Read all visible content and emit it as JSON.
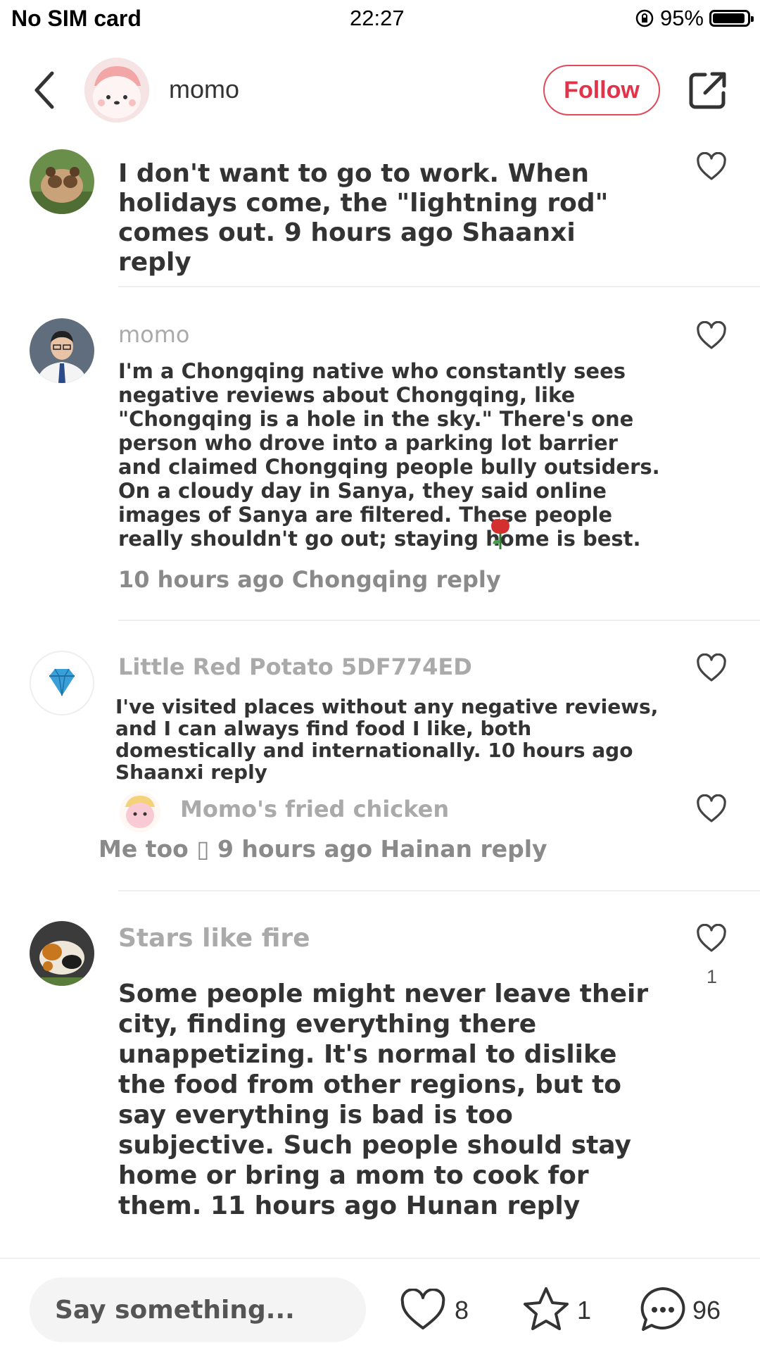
{
  "status_bar": {
    "carrier": "No SIM card",
    "time": "22:27",
    "battery": "95%",
    "battery_level": 0.95
  },
  "header": {
    "username": "momo",
    "follow_label": "Follow"
  },
  "comments": [
    {
      "text": "I don't want to go to work. When holidays come, the \"lightning rod\" comes out. 9 hours ago Shaanxi reply"
    },
    {
      "username": "momo",
      "text": "I'm a Chongqing native who constantly sees negative reviews about Chongqing, like \"Chongqing is a hole in the sky.\" There's one person who drove into a parking lot barrier and claimed Chongqing people bully outsiders. On a cloudy day in Sanya, they said online images of Sanya are filtered. These people really shouldn't go out; staying home is best.",
      "meta": "10 hours ago Chongqing reply"
    },
    {
      "username": "Little Red Potato 5DF774ED",
      "text": "I've visited places without any negative reviews, and I can always find food I like, both domestically and internationally. 10 hours ago Shaanxi reply",
      "reply": {
        "username": "Momo's fried chicken",
        "text": "Me too ▯ 9 hours ago Hainan reply"
      }
    },
    {
      "username": "Stars like fire",
      "text": "Some people might never leave their city, finding everything there unappetizing. It's normal to dislike the food from other regions, but to say everything is bad is too subjective. Such people should stay home or bring a mom to cook for them. 11 hours ago Hunan reply",
      "likes": "1"
    }
  ],
  "bottom_bar": {
    "input_placeholder": "Say something...",
    "likes": "8",
    "stars": "1",
    "comments": "96"
  },
  "colors": {
    "follow_accent": "#e0344a",
    "text": "#333333",
    "muted": "#aaaaaa"
  }
}
